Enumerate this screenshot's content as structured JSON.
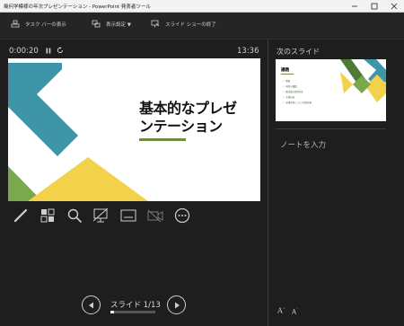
{
  "window": {
    "title": "幾何学模様の年次プレゼンテーション - PowerPoint 発表者ツール",
    "minimize": "–",
    "maximize": "□",
    "close": "✕"
  },
  "toolbar": {
    "taskbar_label": "タスク バーの表示",
    "display_settings_label": "表示設定 ▼",
    "end_show_label": "スライド ショーの終了"
  },
  "presenter": {
    "elapsed": "0:00:20",
    "clock": "13:36"
  },
  "current_slide": {
    "title_line1": "基本的なプレゼ",
    "title_line2": "ンテーション"
  },
  "tools": [
    "pen-tool",
    "see-all-slides",
    "zoom",
    "black-screen",
    "subtitles",
    "camera-off",
    "more-options"
  ],
  "next_slide": {
    "label": "次のスライド",
    "heading": "議題",
    "items": [
      "概要",
      "現状の課題",
      "解決策の提案内容",
      "実施計画",
      "投資効果とコスト削減効果"
    ]
  },
  "notes": {
    "placeholder": "ノートを入力"
  },
  "navigation": {
    "slide_count": "スライド 1/13",
    "progress": 0.077
  },
  "font_size": {
    "increase": "A",
    "decrease": "A"
  },
  "colors": {
    "teal": "#3e95a8",
    "green": "#7aa84c",
    "yellow": "#f2d24a",
    "dark_green": "#4f7a35"
  }
}
